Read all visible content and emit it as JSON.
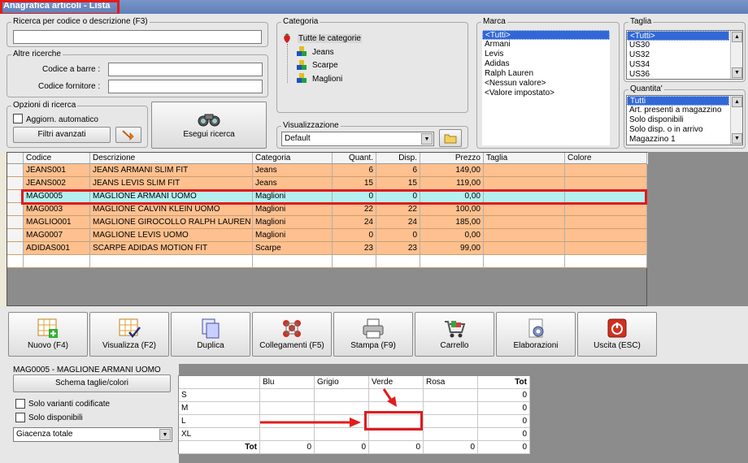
{
  "window": {
    "title": "Anagrafica articoli  - Lista"
  },
  "search": {
    "group_label": "Ricerca per codice o descrizione (F3)",
    "value": "",
    "other_label": "Altre ricerche",
    "barcode_label": "Codice a barre :",
    "supplier_label": "Codice fornitore :",
    "options_label": "Opzioni di ricerca",
    "auto_update_label": "Aggiorn. automatico",
    "advanced_filters_label": "Filtri avanzati",
    "run_search_label": "Esegui ricerca"
  },
  "category": {
    "label": "Categoria",
    "items": [
      "Tutte le categorie",
      "Jeans",
      "Scarpe",
      "Maglioni"
    ]
  },
  "view": {
    "label": "Visualizzazione",
    "value": "Default"
  },
  "brand": {
    "label": "Marca",
    "items": [
      "<Tutti>",
      "Armani",
      "Levis",
      "Adidas",
      "Ralph Lauren",
      "<Nessun valore>",
      "<Valore impostato>"
    ],
    "selected": 0
  },
  "size": {
    "label": "Taglia",
    "items": [
      "<Tutti>",
      "US30",
      "US32",
      "US34",
      "US36"
    ],
    "selected": 0
  },
  "quantity": {
    "label": "Quantita'",
    "items": [
      "Tutti",
      "Art. presenti a magazzino",
      "Solo disponibili",
      "Solo disp. o in arrivo",
      "Magazzino 1"
    ],
    "selected": 0
  },
  "table": {
    "columns": [
      "Codice",
      "Descrizione",
      "Categoria",
      "Quant.",
      "Disp.",
      "Prezzo",
      "Taglia",
      "Colore"
    ],
    "rows": [
      [
        "JEANS001",
        "JEANS ARMANI SLIM FIT",
        "Jeans",
        "6",
        "6",
        "149,00",
        "",
        ""
      ],
      [
        "JEANS002",
        "JEANS LEVIS SLIM  FIT",
        "Jeans",
        "15",
        "15",
        "119,00",
        "",
        ""
      ],
      [
        "MAG0005",
        "MAGLIONE ARMANI UOMO",
        "Maglioni",
        "0",
        "0",
        "0,00",
        "",
        ""
      ],
      [
        "MAG0003",
        "MAGLIONE CALVIN KLEIN UOMO",
        "Maglioni",
        "22",
        "22",
        "100,00",
        "",
        ""
      ],
      [
        "MAGLIO001",
        "MAGLIONE GIROCOLLO RALPH LAUREN",
        "Maglioni",
        "24",
        "24",
        "185,00",
        "",
        ""
      ],
      [
        "MAG0007",
        "MAGLIONE LEVIS UOMO",
        "Maglioni",
        "0",
        "0",
        "0,00",
        "",
        ""
      ],
      [
        "ADIDAS001",
        "SCARPE ADIDAS MOTION FIT",
        "Scarpe",
        "23",
        "23",
        "99,00",
        "",
        ""
      ]
    ],
    "selected_row": 2,
    "colors": {
      "row": "#ffc08f",
      "selected": "#b4f0f0"
    }
  },
  "toolbar": {
    "buttons": [
      {
        "label": "Nuovo (F4)",
        "icon": "new-grid-icon"
      },
      {
        "label": "Visualizza (F2)",
        "icon": "view-grid-icon"
      },
      {
        "label": "Duplica",
        "icon": "duplicate-icon"
      },
      {
        "label": "Collegamenti (F5)",
        "icon": "links-icon"
      },
      {
        "label": "Stampa (F9)",
        "icon": "printer-icon"
      },
      {
        "label": "Carrello",
        "icon": "cart-icon"
      },
      {
        "label": "Elaborazioni",
        "icon": "gear-icon"
      },
      {
        "label": "Uscita (ESC)",
        "icon": "power-icon"
      }
    ]
  },
  "detail": {
    "title": "MAG0005 - MAGLIONE ARMANI UOMO",
    "scheme_button": "Schema taglie/colori",
    "only_coded_label": "Solo varianti codificate",
    "only_available_label": "Solo disponibili",
    "stock_select": "Giacenza totale",
    "matrix": {
      "columns": [
        "Blu",
        "Grigio",
        "Verde",
        "Rosa"
      ],
      "total_label": "Tot",
      "rows": [
        {
          "size": "S",
          "total": "0"
        },
        {
          "size": "M",
          "total": "0"
        },
        {
          "size": "L",
          "total": "0"
        },
        {
          "size": "XL",
          "total": "0"
        }
      ],
      "footer_label": "Tot",
      "footer": [
        "0",
        "0",
        "0",
        "0",
        "0"
      ]
    }
  }
}
